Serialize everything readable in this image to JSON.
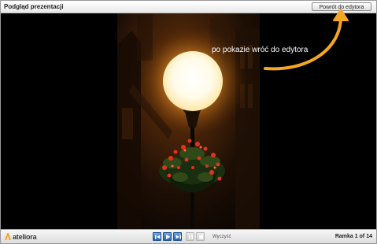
{
  "window": {
    "title": "Podgląd prezentacji",
    "back_button_label": "Powrót do edytora"
  },
  "slide": {
    "annotation_text": "po pokazie wróć do edytora",
    "annotation_color": "#f5a623"
  },
  "footer": {
    "logo_text": "ateliora",
    "logo_color": "#f5a623",
    "controls": [
      {
        "name": "first-slide-button",
        "icon": "skip-to-start-icon"
      },
      {
        "name": "play-button",
        "icon": "play-icon"
      },
      {
        "name": "last-slide-button",
        "icon": "skip-to-end-icon"
      },
      {
        "name": "pause-button",
        "icon": "pause-icon"
      },
      {
        "name": "stop-button",
        "icon": "stop-icon"
      }
    ],
    "clear_label": "Wyczyść",
    "frame_label": "Ramka",
    "frame_current": "1",
    "frame_of": "of",
    "frame_total": "14"
  }
}
